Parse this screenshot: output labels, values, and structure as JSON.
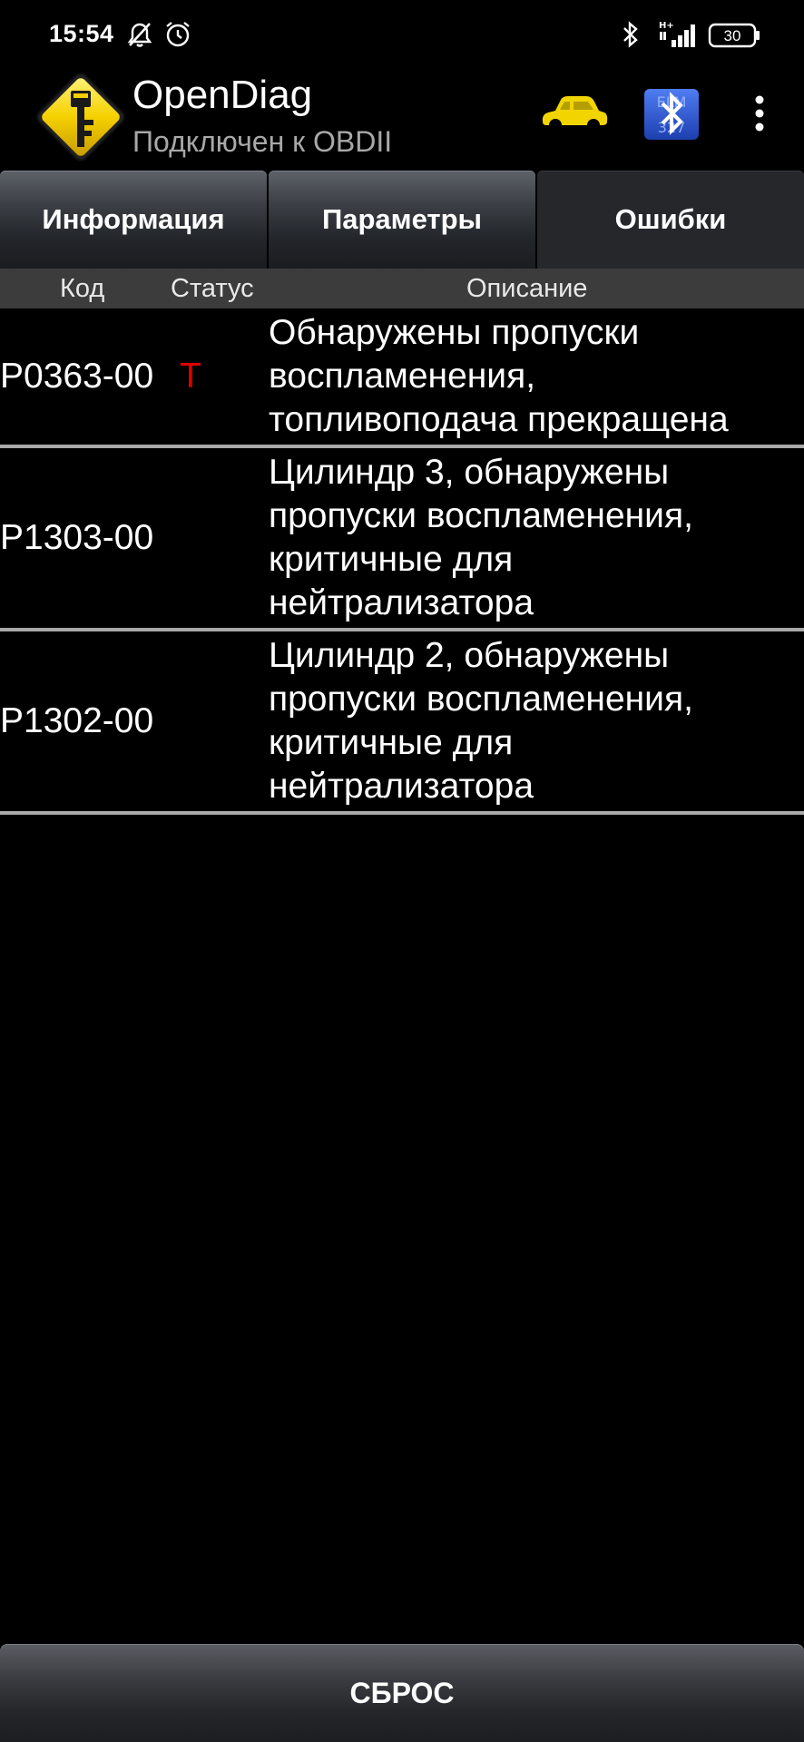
{
  "status_bar": {
    "time": "15:54",
    "battery": "30",
    "icons": [
      "notifications-off-icon",
      "alarm-icon",
      "bluetooth-icon",
      "signal-icon",
      "battery-icon"
    ]
  },
  "app_bar": {
    "title": "OpenDiag",
    "subtitle": "Подключен к OBDII",
    "icons": [
      "app-logo-icon",
      "car-icon",
      "elm327-bluetooth-icon",
      "overflow-menu-icon"
    ]
  },
  "tabs": [
    {
      "label": "Информация",
      "active": false
    },
    {
      "label": "Параметры",
      "active": false
    },
    {
      "label": "Ошибки",
      "active": true
    }
  ],
  "columns": {
    "code": "Код",
    "status": "Статус",
    "description": "Описание"
  },
  "errors": [
    {
      "code": "P0363-00",
      "status": "T",
      "description": [
        "Обнаружены пропуски",
        "воспламенения,",
        "топливоподача прекращена"
      ]
    },
    {
      "code": "P1303-00",
      "status": "",
      "description": [
        "Цилиндр 3, обнаружены",
        "пропуски воспламенения,",
        "критичные для",
        "нейтрализатора"
      ]
    },
    {
      "code": "P1302-00",
      "status": "",
      "description": [
        "Цилиндр 2, обнаружены",
        "пропуски воспламенения,",
        "критичные для",
        "нейтрализатора"
      ]
    }
  ],
  "reset_button": {
    "label": "СБРОС"
  },
  "colors": {
    "background": "#000000",
    "status_red": "#e00000",
    "car_yellow": "#f2d500",
    "header_bg": "#3c3c3c",
    "divider": "#a9a9a9"
  }
}
